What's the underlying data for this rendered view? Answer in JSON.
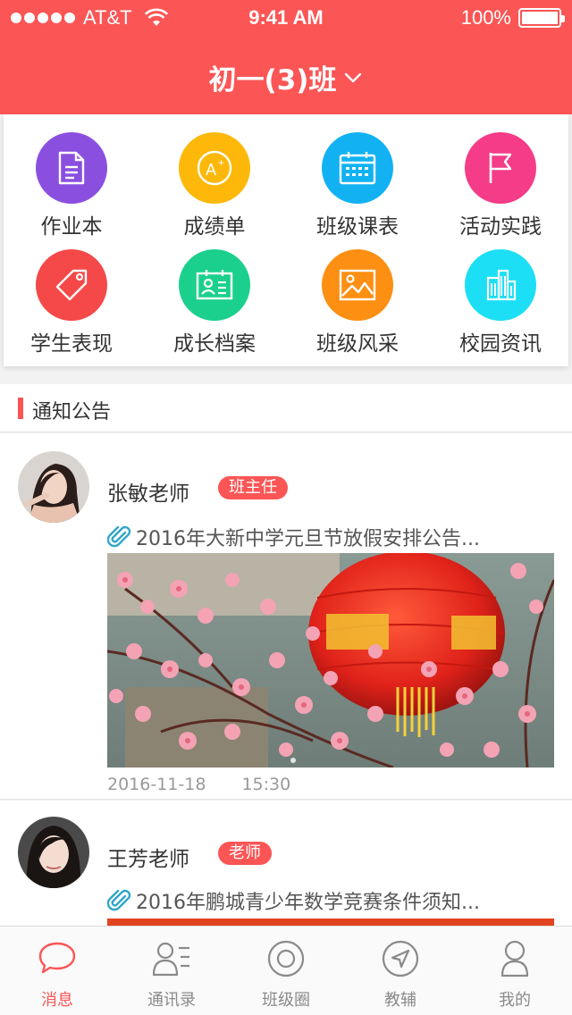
{
  "status_bar": {
    "carrier": "AT&T",
    "time": "9:41 AM",
    "battery": "100%"
  },
  "header": {
    "title": "初一(3)班",
    "dropdown_icon": "chevron-down-icon"
  },
  "features": [
    {
      "label": "作业本",
      "icon": "homework-icon",
      "color": "#8b4fe0"
    },
    {
      "label": "成绩单",
      "icon": "grade-icon",
      "color": "#fdb80a"
    },
    {
      "label": "班级课表",
      "icon": "calendar-icon",
      "color": "#12b2f2"
    },
    {
      "label": "活动实践",
      "icon": "flag-icon",
      "color": "#f43c88"
    },
    {
      "label": "学生表现",
      "icon": "tag-icon",
      "color": "#f54848"
    },
    {
      "label": "成长档案",
      "icon": "profile-card-icon",
      "color": "#1bd08c"
    },
    {
      "label": "班级风采",
      "icon": "picture-icon",
      "color": "#fd8f12"
    },
    {
      "label": "校园资讯",
      "icon": "building-icon",
      "color": "#1cdff5"
    }
  ],
  "notices": {
    "section_title": "通知公告",
    "posts": [
      {
        "author": "张敏老师",
        "role": "班主任",
        "title": "2016年大新中学元旦节放假安排公告...",
        "date": "2016-11-18",
        "time": "15:30"
      },
      {
        "author": "王芳老师",
        "role": "老师",
        "title": "2016年鹏城青少年数学竞赛条件须知..."
      }
    ]
  },
  "tabs": [
    {
      "label": "消息",
      "icon": "chat-bubble-icon",
      "active": true
    },
    {
      "label": "通讯录",
      "icon": "contacts-icon",
      "active": false
    },
    {
      "label": "班级圈",
      "icon": "circle-icon",
      "active": false
    },
    {
      "label": "教辅",
      "icon": "compass-icon",
      "active": false
    },
    {
      "label": "我的",
      "icon": "user-icon",
      "active": false
    }
  ],
  "colors": {
    "brand": "#fb5555",
    "background": "#f2f2f2"
  }
}
